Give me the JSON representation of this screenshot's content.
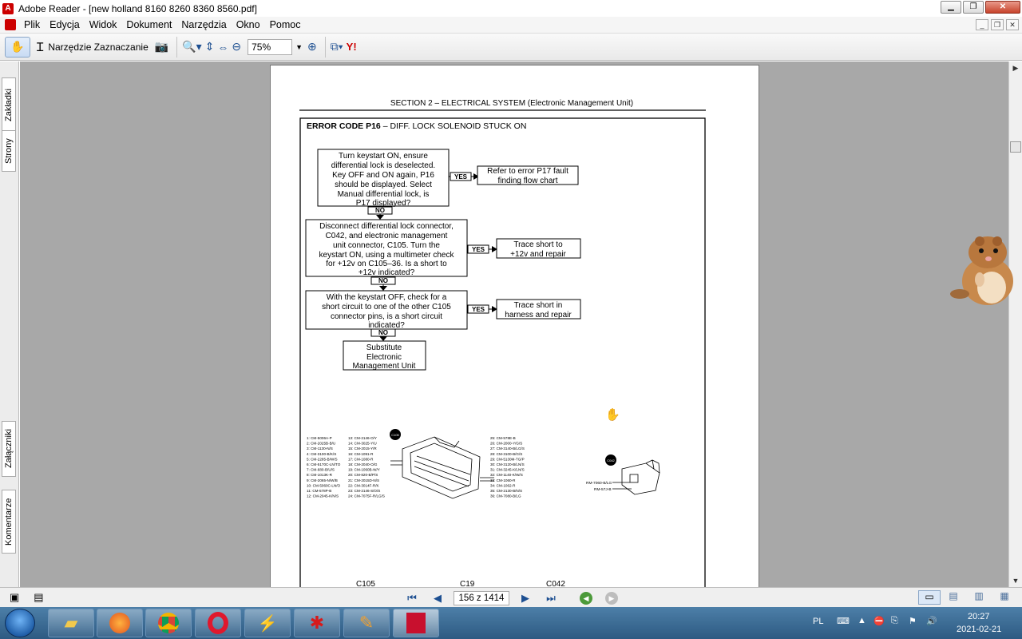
{
  "window": {
    "title": "Adobe Reader - [new holland 8160 8260 8360 8560.pdf]"
  },
  "menu": [
    "Plik",
    "Edycja",
    "Widok",
    "Dokument",
    "Narzędzia",
    "Okno",
    "Pomoc"
  ],
  "toolbar": {
    "select_tool_label": "Narzędzie Zaznaczanie",
    "zoom_value": "75%"
  },
  "left_tabs": {
    "bookmarks": "Zakładki",
    "pages": "Strony",
    "attachments": "Załączniki",
    "comments": "Komentarze"
  },
  "document": {
    "header": "SECTION 2 – ELECTRICAL SYSTEM (Electronic Management Unit)",
    "error_code_bold": "ERROR CODE P16",
    "error_code_rest": " – DIFF. LOCK SOLENOID STUCK ON",
    "box1": [
      "Turn keystart ON, ensure",
      "differential lock is deselected.",
      "Key OFF and ON again, P16",
      "should be displayed. Select",
      "Manual differential  lock, is",
      "P17 displayed?"
    ],
    "res1": [
      "Refer to error P17 fault",
      "finding flow chart"
    ],
    "box2": [
      "Disconnect differential lock connector,",
      "C042, and electronic management",
      "unit connector, C105. Turn the",
      "keystart ON, using a multimeter check",
      "for +12v on C105–36. Is a short to",
      "+12v  indicated?"
    ],
    "res2": [
      "Trace short to",
      "+12v  and repair"
    ],
    "box3": [
      "With the keystart OFF, check for a",
      "short circuit to one of the other C105",
      "connector pins, is a short circuit",
      "indicated?"
    ],
    "res3": [
      "Trace short in",
      "harness and repair"
    ],
    "box4": [
      "Substitute",
      "Electronic",
      "Management Unit"
    ],
    "yes": "YES",
    "no": "NO",
    "conn_c105_badge": "C105",
    "conn_c042_badge": "C042",
    "pins_col1": [
      "1: CM-5006A-P",
      "2: CM-2025B-B/U",
      "3: CM-1130-N/S",
      "4: CM-3100-B/K/S",
      "5: CM-2285-B/W/S",
      "6: CM-5170C-LN/TO",
      "7: CM-680-B/U/S",
      "8: CM-1013K-R",
      "9: CM-2065-N/W/B",
      "10: CM-5060C-LN/O",
      "11: CM-578P-B",
      "12: CM-2045-K/N/S"
    ],
    "pins_col2": [
      "13: CM-2146-O/Y",
      "14: CM-3025-Y/U",
      "15: CM-2015-Y/R",
      "16: CM-1091-R",
      "17: CM-1080-R",
      "18: CM-2040-O/G",
      "19: CM-1060B-W/Y",
      "20: CM-820-B/P/S",
      "21: CM-2015D-N/S",
      "22: CM-3014F-R/K",
      "23: CM-2146-S/O/S",
      "24: CM-7075F-R/LG/S"
    ],
    "pins_col3": [
      "25: CM-578E-B",
      "26: CM-2000-Y/G/S",
      "27: CM-3140-B/LG/S",
      "28: CM-3100-B/G/S",
      "29: CM-5130M-TG/P",
      "30: CM-3120-B/LN/S",
      "31: CM-3245-K/LN/S",
      "32: CM-1140-K/W/S",
      "33: CM-1060-R",
      "34: CM-1062-R",
      "35: CM-2130-B/N/S",
      "36: CM-7080-B/LG"
    ],
    "c042_pins": [
      "RM-7060-B/LG",
      "RM-57J-B"
    ],
    "bottom_labels": [
      "C105",
      "C19",
      "C042"
    ]
  },
  "statusbar": {
    "page_display": "156 z 1414"
  },
  "taskbar": {
    "lang": "PL",
    "time": "20:27",
    "date": "2021-02-21"
  }
}
